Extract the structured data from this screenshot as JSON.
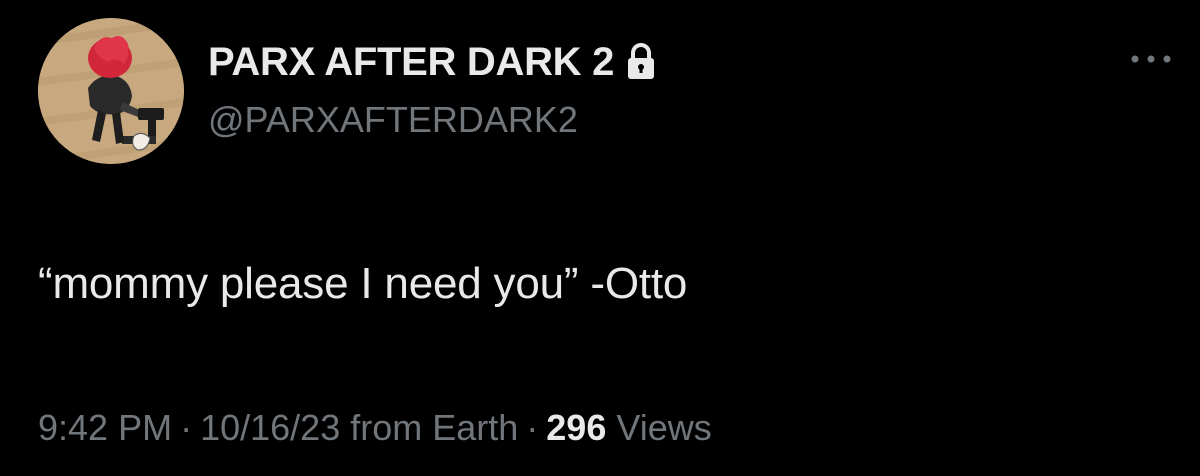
{
  "author": {
    "display_name": "PARX AFTER DARK 2",
    "handle": "@PARXAFTERDARK2",
    "protected_icon": "lock-icon",
    "avatar_icon": "profile-avatar"
  },
  "menu": {
    "icon": "more-horizontal-icon"
  },
  "tweet": {
    "text": "“mommy please I need you” -Otto",
    "time": "9:42 PM",
    "date": "10/16/23",
    "source": "from Earth",
    "separator": "·",
    "views_count": "296",
    "views_label": "Views"
  },
  "colors": {
    "background": "#000000",
    "primary_text": "#e7e9ea",
    "secondary_text": "#71767b"
  }
}
